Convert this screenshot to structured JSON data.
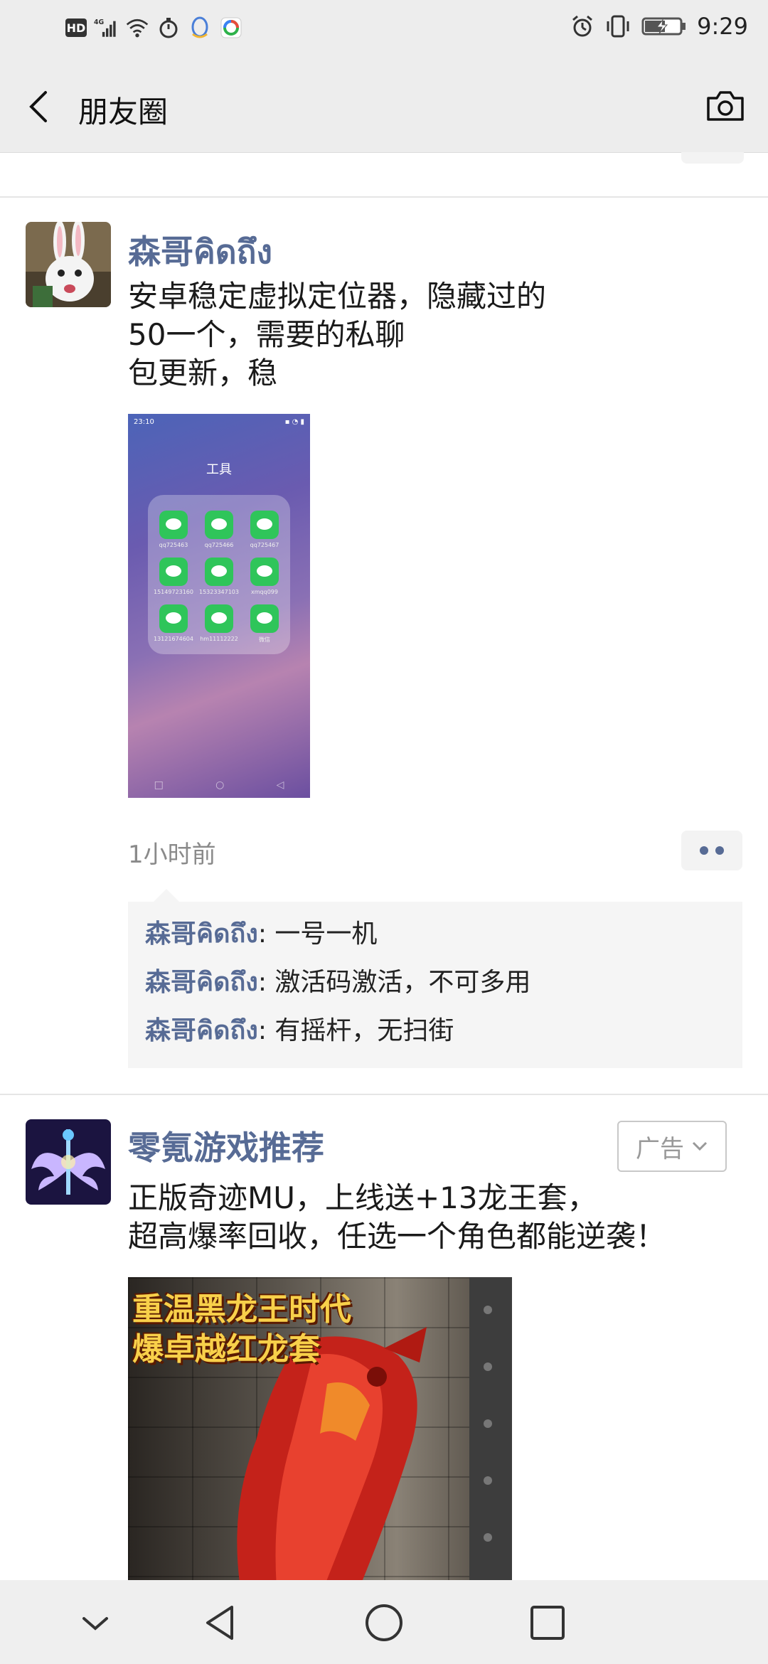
{
  "status_bar": {
    "left_badges": [
      "HD",
      "4G"
    ],
    "time": "9:29",
    "icons": [
      "hd-icon",
      "signal-icon",
      "wifi-icon",
      "stopwatch-icon",
      "qq-icon",
      "app-icon",
      "alarm-icon",
      "vibrate-icon",
      "battery-charging-icon"
    ]
  },
  "header": {
    "title": "朋友圈",
    "back_icon": "chevron-left-icon",
    "camera_icon": "camera-icon"
  },
  "post1": {
    "username": "森哥คิดถึง",
    "text_lines": [
      "安卓稳定虚拟定位器，隐藏过的",
      "50一个，需要的私聊",
      "包更新，稳"
    ],
    "image": {
      "status_time": "23:10",
      "folder_title": "工具",
      "app_labels": [
        "qq725463",
        "qq725466",
        "qq725467",
        "15149723160",
        "15323347103",
        "xmqq099",
        "13121674604",
        "hm11112222",
        "微信"
      ]
    },
    "time": "1小时前",
    "comments": [
      {
        "name": "森哥คิดถึง",
        "text": ": 一号一机"
      },
      {
        "name": "森哥คิดถึง",
        "text": ": 激活码激活，不可多用"
      },
      {
        "name": "森哥คิดถึง",
        "text": ": 有摇杆，无扫街"
      }
    ]
  },
  "post2": {
    "username": "零氪游戏推荐",
    "ad_label": "广告",
    "text_lines": [
      "正版奇迹MU，上线送+13龙王套，",
      "超高爆率回收，任选一个角色都能逆袭！"
    ],
    "image_caption": [
      "重温黑龙王时代",
      "爆卓越红龙套"
    ]
  },
  "nav_bar": {
    "icons": [
      "chevron-down-icon",
      "back-triangle-icon",
      "home-circle-icon",
      "recents-square-icon"
    ]
  },
  "colors": {
    "link_blue": "#576b95",
    "header_bg": "#ededed",
    "comment_bg": "#f5f5f5"
  }
}
